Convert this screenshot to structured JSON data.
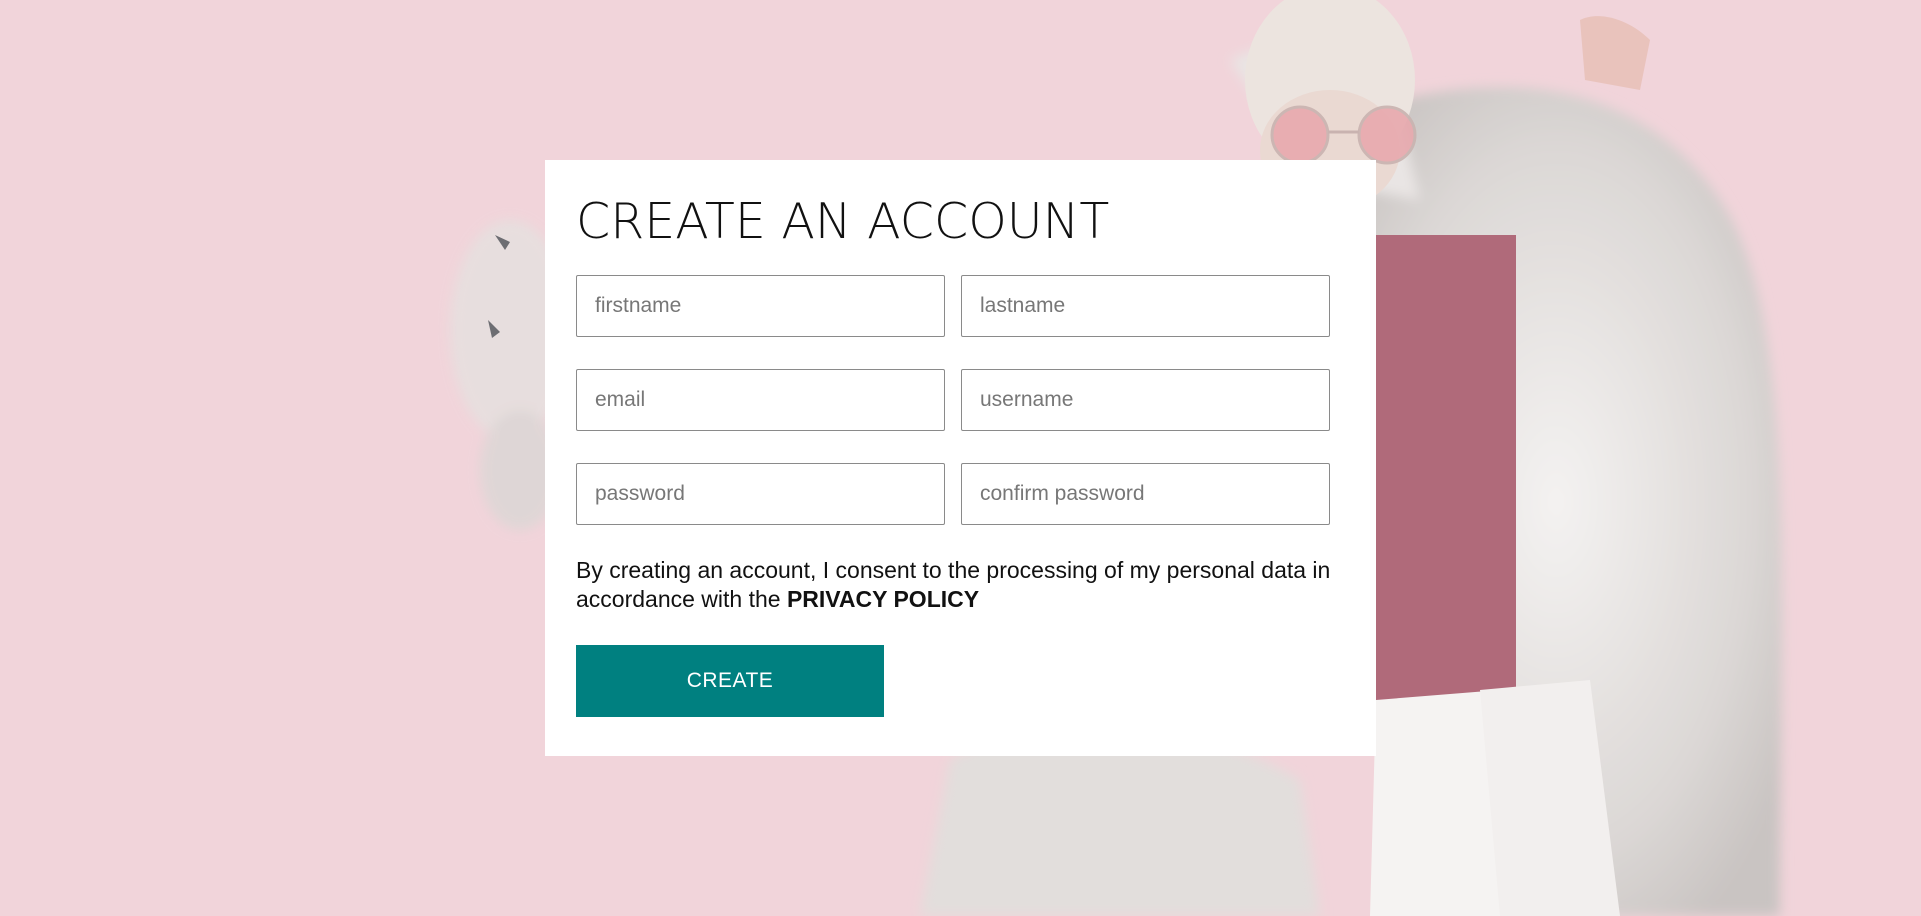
{
  "form": {
    "title": "CREATE AN ACCOUNT",
    "fields": {
      "firstname": "firstname",
      "lastname": "lastname",
      "email": "email",
      "username": "username",
      "password": "password",
      "confirm_password": "confirm password"
    },
    "consent_text": "By creating an account, I consent to the processing of my personal data in accordance with the ",
    "privacy_link": "PRIVACY POLICY",
    "submit_label": "CREATE"
  },
  "colors": {
    "background": "#f1d4da",
    "card": "#ffffff",
    "accent": "#008080",
    "text": "#111111"
  }
}
